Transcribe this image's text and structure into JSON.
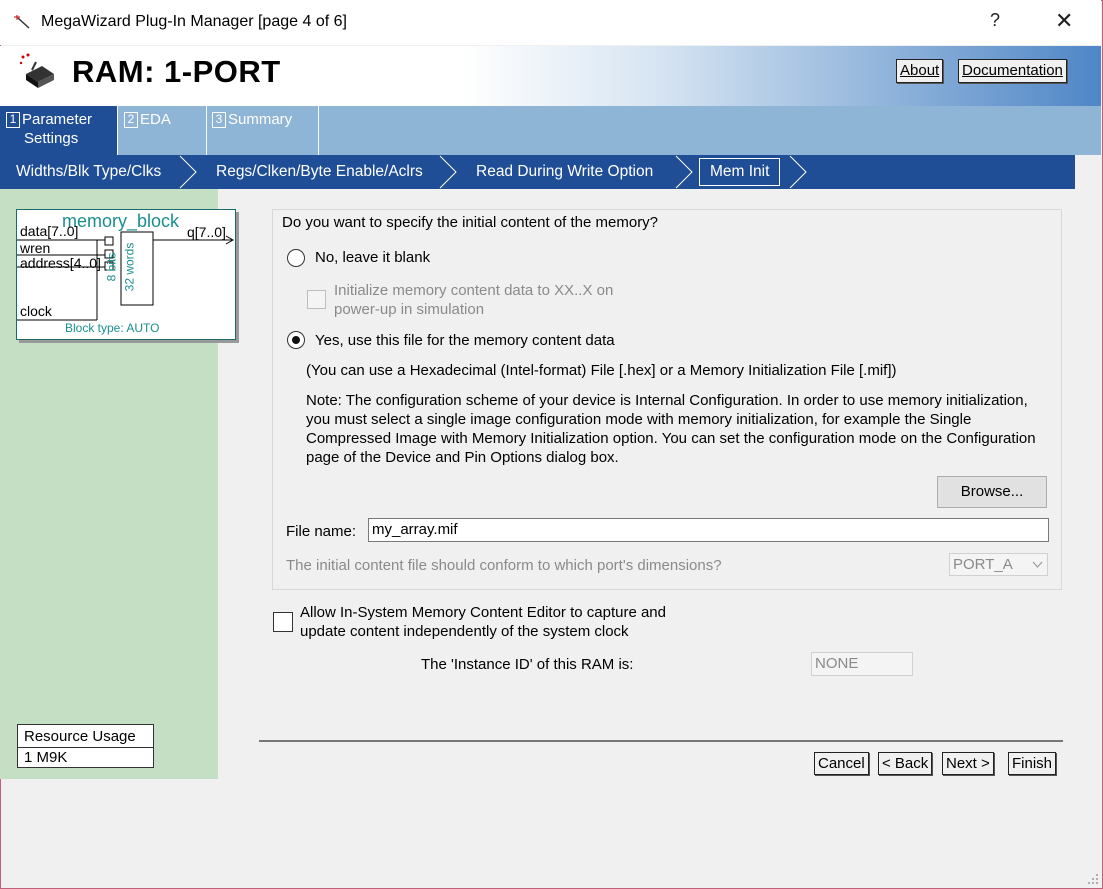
{
  "window": {
    "title": "MegaWizard Plug-In Manager [page 4 of 6]",
    "help_label": "?",
    "close_label": "✕"
  },
  "header": {
    "heading": "RAM: 1-PORT",
    "about_label": "About",
    "documentation_label": "Documentation"
  },
  "tabs": [
    {
      "num": "1",
      "label_line1": "Parameter",
      "label_line2": "Settings"
    },
    {
      "num": "2",
      "label_line1": "EDA",
      "label_line2": ""
    },
    {
      "num": "3",
      "label_line1": "Summary",
      "label_line2": ""
    }
  ],
  "breadcrumbs": [
    "Widths/Blk Type/Clks",
    "Regs/Clken/Byte Enable/Aclrs",
    "Read During Write Option",
    "Mem Init"
  ],
  "block": {
    "name": "memory_block",
    "ports_in": [
      "data[7..0]",
      "wren",
      "address[4..0]",
      "clock"
    ],
    "port_out": "q[7..0]",
    "inner_text_1": "8 bits",
    "inner_text_2": "32 words",
    "block_type": "Block type: AUTO"
  },
  "resource": {
    "header": "Resource Usage",
    "value": "1 M9K"
  },
  "memory_content": {
    "question": "Do you want to specify the initial content of the memory?",
    "option_blank": "No, leave it blank",
    "init_xx_line1": "Initialize memory content data to XX..X on",
    "init_xx_line2": "power-up in simulation",
    "option_file": "Yes, use this file for the memory content data",
    "file_types": "(You can use a Hexadecimal (Intel-format) File [.hex] or a Memory Initialization File [.mif])",
    "note": "Note: The configuration scheme of your device is Internal Configuration. In order to use memory initialization, you must select a single image configuration mode with memory initialization, for example the Single Compressed Image with Memory Initialization option. You can set the configuration mode on the Configuration page of the Device and Pin Options dialog box.",
    "browse_label": "Browse...",
    "file_name_label": "File name:",
    "file_name_value": "my_array.mif",
    "port_question": "The initial content file should conform to which port's dimensions?",
    "port_value": "PORT_A",
    "selected_option": "file"
  },
  "in_system": {
    "line1": "Allow In-System Memory Content Editor to capture and",
    "line2": "update content independently of the system clock",
    "instance_label": "The 'Instance ID' of this RAM is:",
    "instance_value": "NONE",
    "checked": false
  },
  "footer": {
    "cancel": "Cancel",
    "back": "< Back",
    "next": "Next >",
    "finish": "Finish"
  },
  "colors": {
    "tab_active": "#1f4e96",
    "tab_bar": "#8eb4d6",
    "left_panel": "#c4dfc4",
    "block_text": "#1a8f8f"
  }
}
